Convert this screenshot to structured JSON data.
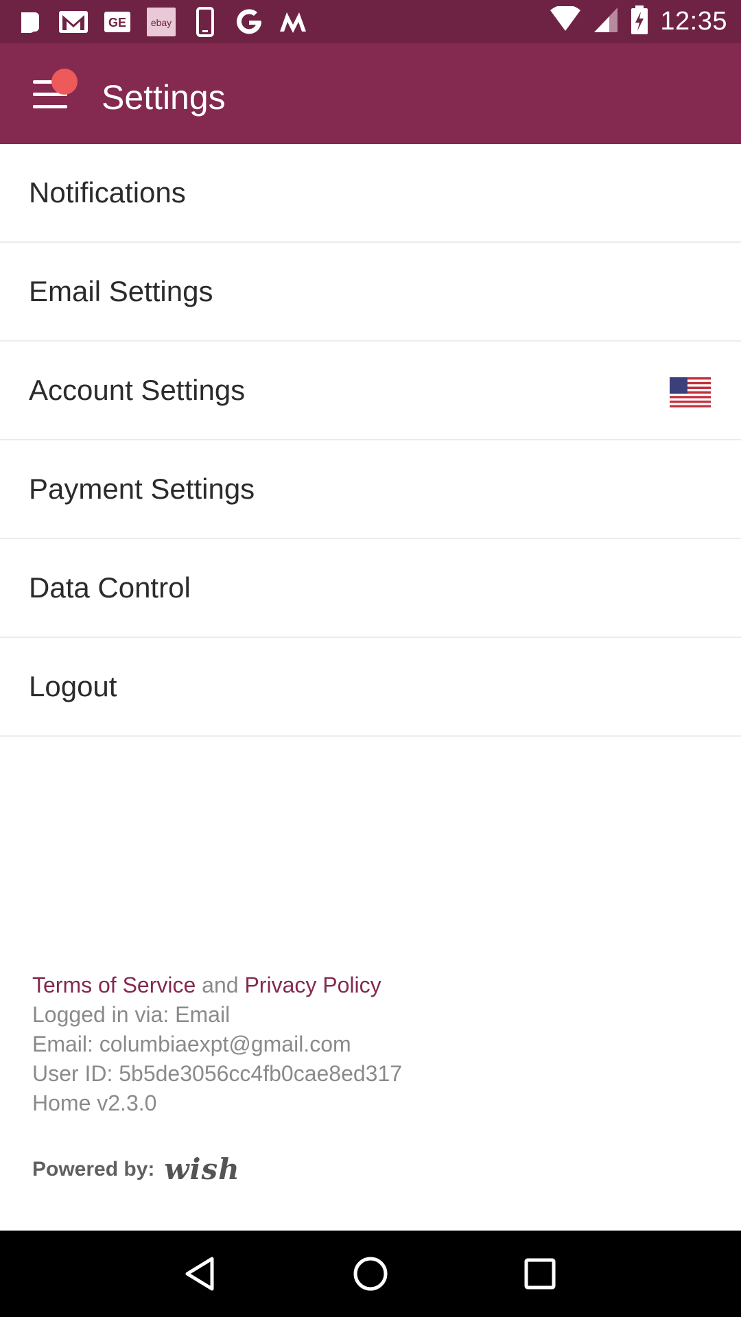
{
  "status_bar": {
    "time": "12:35",
    "left_icons": [
      "b-app-icon",
      "gmail-icon",
      "ge-icon",
      "ebay-icon",
      "phone-icon",
      "google-icon",
      "m-app-icon"
    ],
    "ebay_text": "ebay",
    "ge_text": "GE"
  },
  "app_bar": {
    "title": "Settings",
    "color": "#84294f",
    "notification_dot_color": "#ee5a5a"
  },
  "settings": {
    "items": [
      {
        "label": "Notifications"
      },
      {
        "label": "Email Settings"
      },
      {
        "label": "Account Settings"
      },
      {
        "label": "Payment Settings"
      },
      {
        "label": "Data Control"
      },
      {
        "label": "Logout"
      }
    ]
  },
  "footer": {
    "terms_label": "Terms of Service",
    "and_label": "and",
    "privacy_label": "Privacy Policy",
    "logged_in_via": "Logged in via: Email",
    "email": "Email: columbiaexpt@gmail.com",
    "user_id": "User ID: 5b5de3056cc4fb0cae8ed317",
    "version": "Home v2.3.0",
    "powered_by_label": "Powered by:",
    "brand": "wish"
  },
  "nav_bar": {
    "buttons": [
      "back-icon",
      "home-icon",
      "recents-icon"
    ]
  }
}
